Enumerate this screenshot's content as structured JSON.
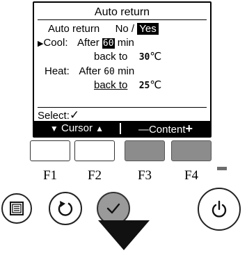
{
  "screen": {
    "title": "Auto return",
    "auto_return": {
      "label": "Auto return",
      "option_no": "No",
      "separator": " /",
      "option_yes": "Yes"
    },
    "cool": {
      "cursor": "▶",
      "label": "Cool:",
      "after_text": "After",
      "minutes": "60",
      "min_unit": "min",
      "back_to_text": "back to",
      "temperature": "30",
      "temp_unit": "℃"
    },
    "heat": {
      "label": "Heat:",
      "after_text": "After",
      "minutes": "60",
      "min_unit": "min",
      "back_to_text": "back to",
      "temperature": "25",
      "temp_unit": "℃"
    },
    "select_label": "Select:",
    "select_icon": "✓",
    "bottom_bar": {
      "cursor_down_icon": "▼",
      "cursor_label": "Cursor",
      "cursor_up_icon": "▲",
      "content_minus_icon": "—",
      "content_label": "Content",
      "content_plus_icon": "+"
    }
  },
  "function_keys": [
    {
      "label": "F1",
      "state": "light"
    },
    {
      "label": "F2",
      "state": "light"
    },
    {
      "label": "F3",
      "state": "dark"
    },
    {
      "label": "F4",
      "state": "dark"
    }
  ],
  "buttons": {
    "menu_icon": "menu-icon",
    "return_icon": "return-icon",
    "select_icon": "check-icon",
    "power_icon": "power-icon"
  },
  "colors": {
    "lcd_inverse": "#000000",
    "fkey_dark": "#8c8c8c",
    "select_button": "#9a9a9a"
  }
}
